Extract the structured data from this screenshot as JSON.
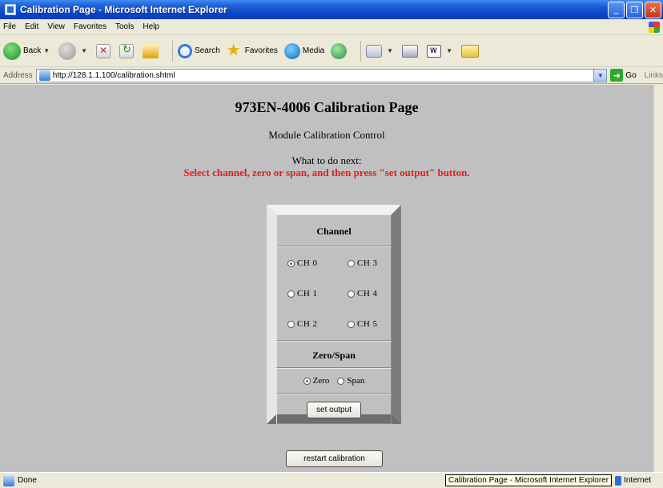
{
  "window": {
    "title": "Calibration Page - Microsoft Internet Explorer",
    "minimize": "‗",
    "maximize": "❐",
    "close": "✕"
  },
  "menu": [
    "File",
    "Edit",
    "View",
    "Favorites",
    "Tools",
    "Help"
  ],
  "toolbar": {
    "back": "Back",
    "search": "Search",
    "favorites": "Favorites",
    "media": "Media"
  },
  "address": {
    "label": "Address",
    "url": "http://128.1.1.100/calibration.shtml",
    "go": "Go",
    "links": "Links"
  },
  "page": {
    "title": "973EN-4006 Calibration Page",
    "subtitle": "Module Calibration Control",
    "next_label": "What to do next:",
    "instructions": "Select channel, zero or span, and then press \"set output\" button.",
    "channel_header": "Channel",
    "channels": [
      {
        "label": "CH  0",
        "checked": true
      },
      {
        "label": "CH  3",
        "checked": false
      },
      {
        "label": "CH  1",
        "checked": false
      },
      {
        "label": "CH  4",
        "checked": false
      },
      {
        "label": "CH  2",
        "checked": false
      },
      {
        "label": "CH  5",
        "checked": false
      }
    ],
    "zerospan_header": "Zero/Span",
    "zero_label": "Zero",
    "zero_checked": true,
    "span_label": "Span",
    "span_checked": false,
    "set_output": "set output",
    "restart": "restart calibration"
  },
  "status": {
    "text": "Done",
    "tooltip": "Calibration Page - Microsoft Internet Explorer",
    "zone": "Internet"
  }
}
